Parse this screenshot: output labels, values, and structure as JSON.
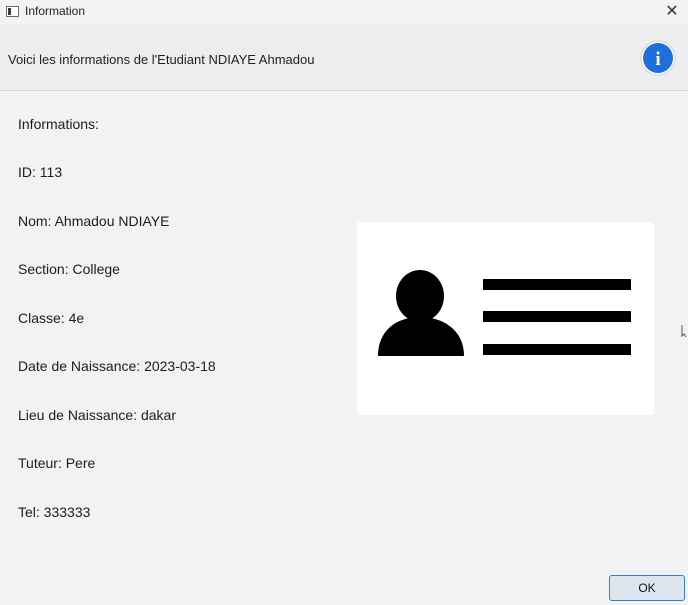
{
  "window": {
    "title": "Information",
    "close_glyph": "✕"
  },
  "header": {
    "message": "Voici les informations de l'Etudiant NDIAYE Ahmadou",
    "icon": "info-icon",
    "icon_letter": "i",
    "accent_color": "#1e6fd9"
  },
  "student": {
    "heading": "Informations:",
    "fields": [
      "ID: 113",
      "Nom: Ahmadou NDIAYE",
      "Section: College",
      "Classe: 4e",
      "Date de Naissance: 2023-03-18",
      "Lieu de Naissance: dakar",
      "Tuteur: Pere",
      "Tel: 333333"
    ]
  },
  "image": {
    "icon": "id-card-icon"
  },
  "buttons": {
    "ok_label": "OK"
  }
}
